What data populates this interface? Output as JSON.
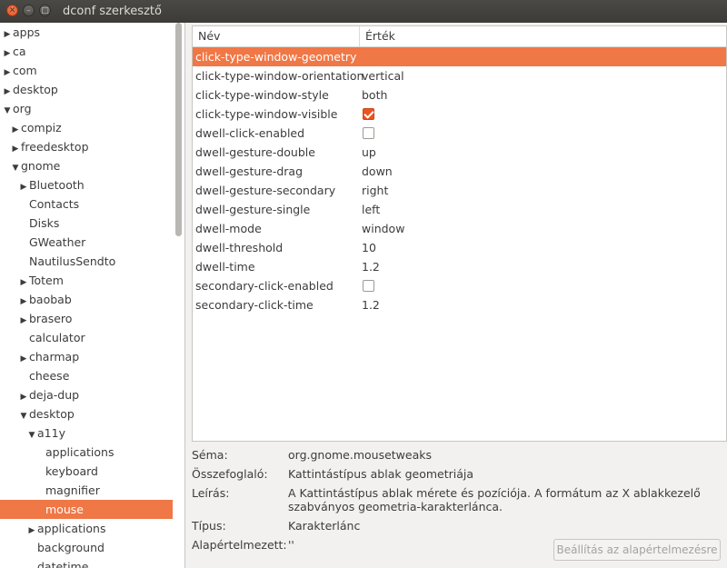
{
  "window": {
    "title": "dconf szerkesztő"
  },
  "tree": [
    {
      "label": "apps",
      "depth": 0,
      "arrow": "right"
    },
    {
      "label": "ca",
      "depth": 0,
      "arrow": "right"
    },
    {
      "label": "com",
      "depth": 0,
      "arrow": "right"
    },
    {
      "label": "desktop",
      "depth": 0,
      "arrow": "right"
    },
    {
      "label": "org",
      "depth": 0,
      "arrow": "down"
    },
    {
      "label": "compiz",
      "depth": 1,
      "arrow": "right"
    },
    {
      "label": "freedesktop",
      "depth": 1,
      "arrow": "right"
    },
    {
      "label": "gnome",
      "depth": 1,
      "arrow": "down"
    },
    {
      "label": "Bluetooth",
      "depth": 2,
      "arrow": "right"
    },
    {
      "label": "Contacts",
      "depth": 2,
      "arrow": ""
    },
    {
      "label": "Disks",
      "depth": 2,
      "arrow": ""
    },
    {
      "label": "GWeather",
      "depth": 2,
      "arrow": ""
    },
    {
      "label": "NautilusSendto",
      "depth": 2,
      "arrow": ""
    },
    {
      "label": "Totem",
      "depth": 2,
      "arrow": "right"
    },
    {
      "label": "baobab",
      "depth": 2,
      "arrow": "right"
    },
    {
      "label": "brasero",
      "depth": 2,
      "arrow": "right"
    },
    {
      "label": "calculator",
      "depth": 2,
      "arrow": ""
    },
    {
      "label": "charmap",
      "depth": 2,
      "arrow": "right"
    },
    {
      "label": "cheese",
      "depth": 2,
      "arrow": ""
    },
    {
      "label": "deja-dup",
      "depth": 2,
      "arrow": "right"
    },
    {
      "label": "desktop",
      "depth": 2,
      "arrow": "down"
    },
    {
      "label": "a11y",
      "depth": 3,
      "arrow": "down"
    },
    {
      "label": "applications",
      "depth": 4,
      "arrow": ""
    },
    {
      "label": "keyboard",
      "depth": 4,
      "arrow": ""
    },
    {
      "label": "magnifier",
      "depth": 4,
      "arrow": ""
    },
    {
      "label": "mouse",
      "depth": 4,
      "arrow": "",
      "selected": true
    },
    {
      "label": "applications",
      "depth": 3,
      "arrow": "right"
    },
    {
      "label": "background",
      "depth": 3,
      "arrow": ""
    },
    {
      "label": "datetime",
      "depth": 3,
      "arrow": ""
    }
  ],
  "list": {
    "headers": {
      "name": "Név",
      "value": "Érték"
    },
    "rows": [
      {
        "key": "click-type-window-geometry",
        "value": "",
        "type": "text",
        "selected": true
      },
      {
        "key": "click-type-window-orientation",
        "value": "vertical",
        "type": "text"
      },
      {
        "key": "click-type-window-style",
        "value": "both",
        "type": "text"
      },
      {
        "key": "click-type-window-visible",
        "value": true,
        "type": "bool"
      },
      {
        "key": "dwell-click-enabled",
        "value": false,
        "type": "bool"
      },
      {
        "key": "dwell-gesture-double",
        "value": "up",
        "type": "text"
      },
      {
        "key": "dwell-gesture-drag",
        "value": "down",
        "type": "text"
      },
      {
        "key": "dwell-gesture-secondary",
        "value": "right",
        "type": "text"
      },
      {
        "key": "dwell-gesture-single",
        "value": "left",
        "type": "text"
      },
      {
        "key": "dwell-mode",
        "value": "window",
        "type": "text"
      },
      {
        "key": "dwell-threshold",
        "value": "10",
        "type": "text"
      },
      {
        "key": "dwell-time",
        "value": "1.2",
        "type": "text"
      },
      {
        "key": "secondary-click-enabled",
        "value": false,
        "type": "bool"
      },
      {
        "key": "secondary-click-time",
        "value": "1.2",
        "type": "text"
      }
    ]
  },
  "details": {
    "schema_label": "Séma:",
    "schema_value": "org.gnome.mousetweaks",
    "summary_label": "Összefoglaló:",
    "summary_value": "Kattintástípus ablak geometriája",
    "description_label": "Leírás:",
    "description_value": "A Kattintástípus ablak mérete és pozíciója. A formátum az X ablakkezelő szabványos geometria-karakterlánca.",
    "type_label": "Típus:",
    "type_value": "Karakterlánc",
    "default_label": "Alapértelmezett:",
    "default_value": "''",
    "reset_button": "Beállítás az alapértelmezésre"
  }
}
